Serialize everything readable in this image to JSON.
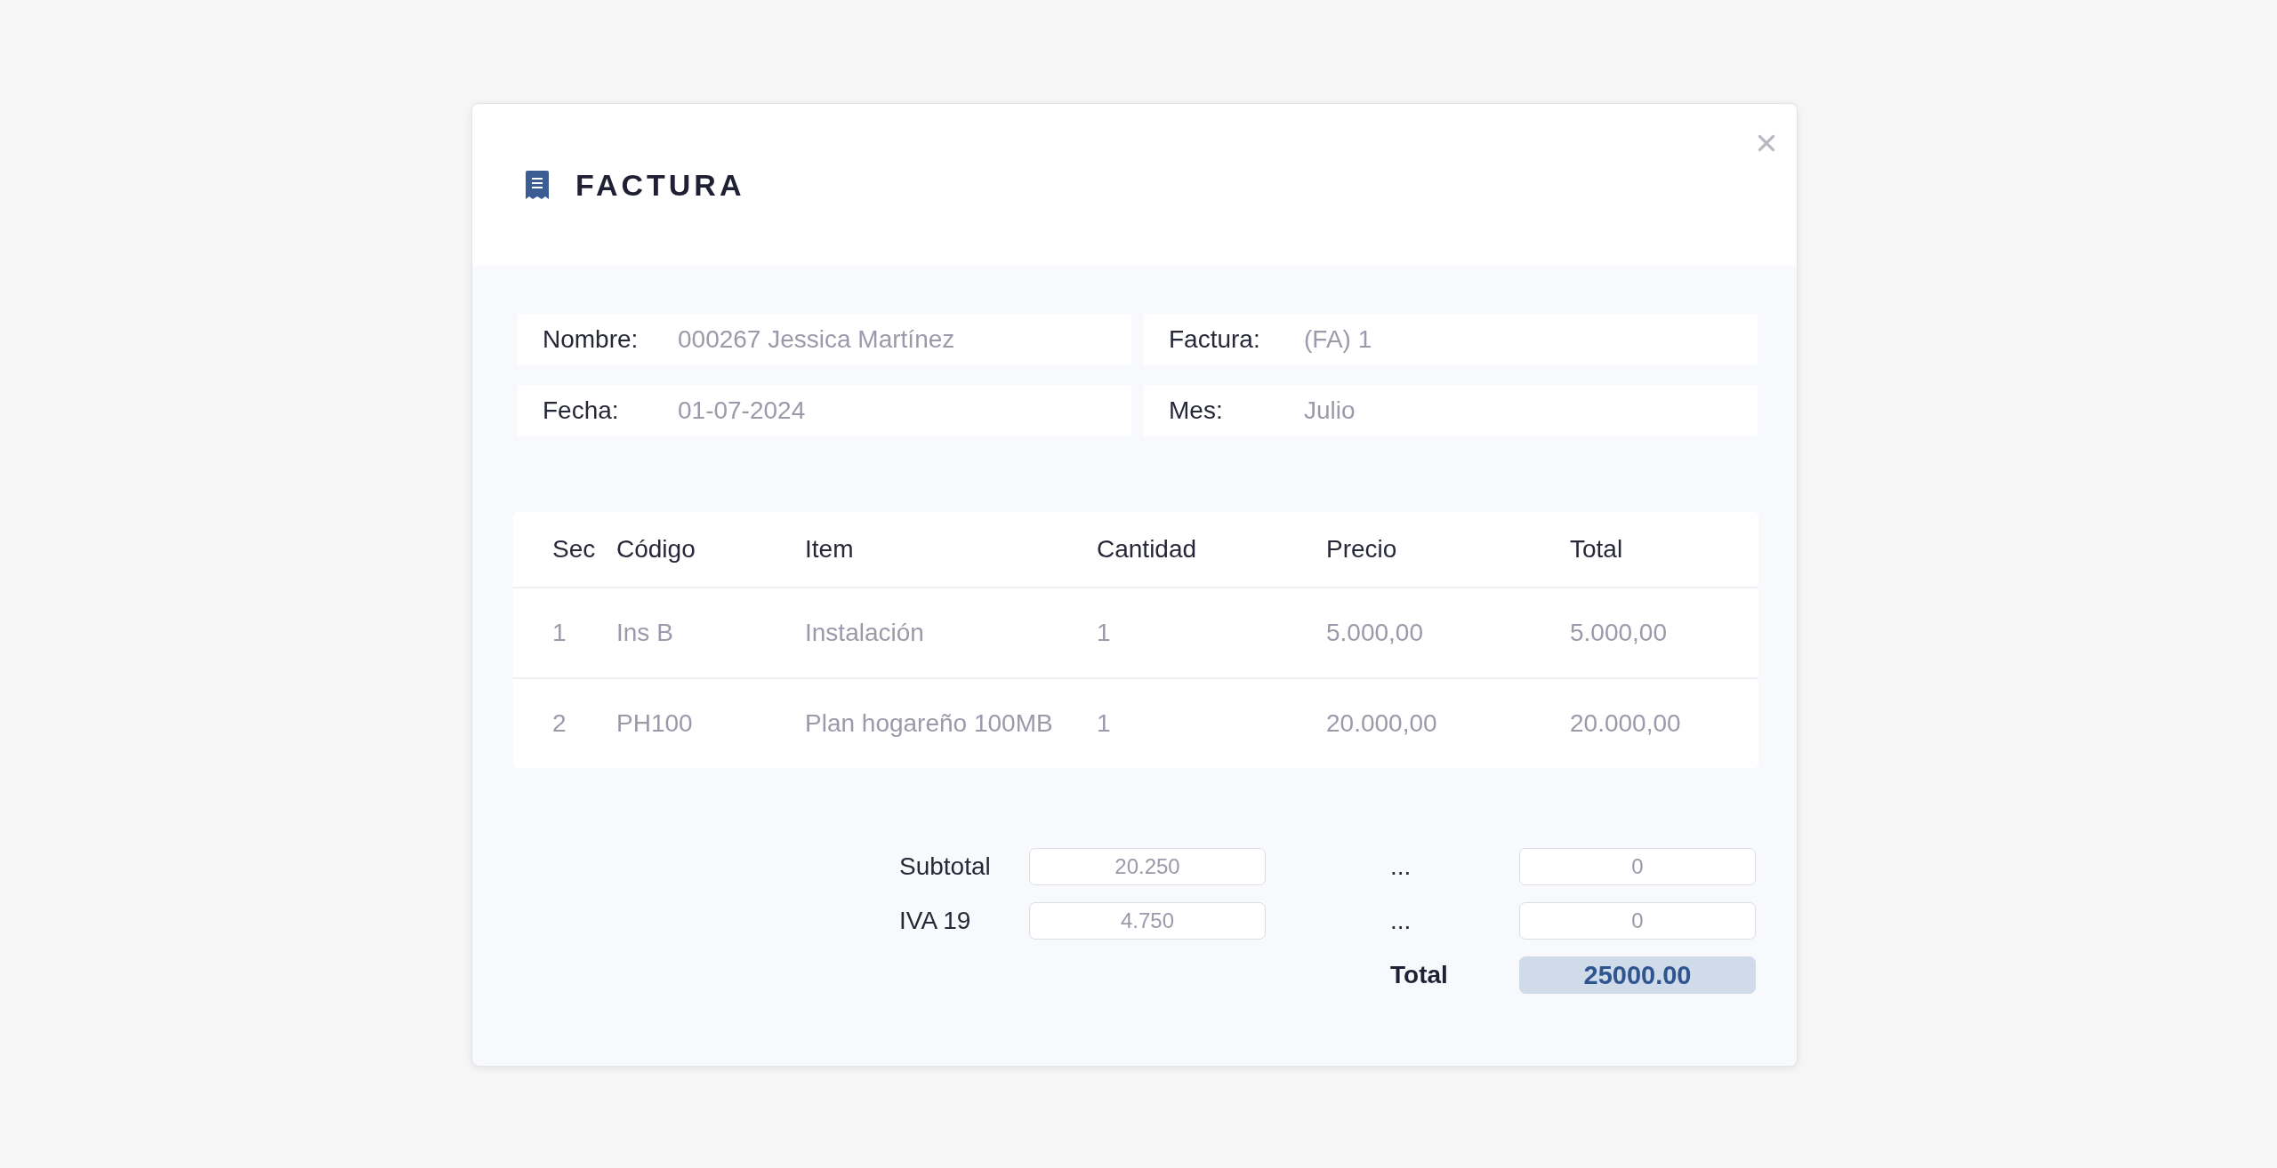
{
  "modal": {
    "title": "FACTURA"
  },
  "info_fields": [
    {
      "label": "Nombre:",
      "value": "000267 Jessica Martínez"
    },
    {
      "label": "Factura:",
      "value": "(FA) 1"
    },
    {
      "label": "Fecha:",
      "value": "01-07-2024"
    },
    {
      "label": "Mes:",
      "value": "Julio"
    }
  ],
  "table": {
    "columns": [
      "Sec",
      "Código",
      "Item",
      "Cantidad",
      "Precio",
      "Total"
    ],
    "rows": [
      [
        "1",
        "Ins B",
        "Instalación",
        "1",
        "5.000,00",
        "5.000,00"
      ],
      [
        "2",
        "PH100",
        "Plan hogareño 100MB",
        "1",
        "20.000,00",
        "20.000,00"
      ]
    ]
  },
  "summary": {
    "left": [
      {
        "label": "Subtotal",
        "value": "20.250"
      },
      {
        "label": "IVA 19",
        "value": "4.750"
      }
    ],
    "right": [
      {
        "label": "...",
        "value": "0"
      },
      {
        "label": "...",
        "value": "0"
      }
    ],
    "total": {
      "label": "Total",
      "value": "25000.00"
    }
  }
}
